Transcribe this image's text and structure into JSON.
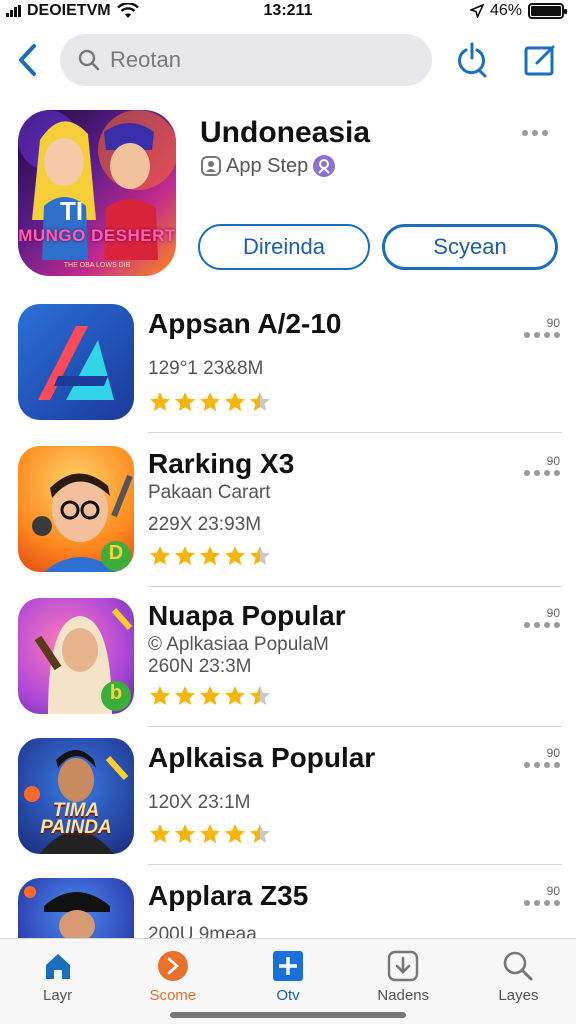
{
  "status_bar": {
    "carrier": "DEOIETVM",
    "time": "13:211",
    "battery": "46%"
  },
  "search": {
    "placeholder": "Reotan"
  },
  "featured": {
    "title": "Undoneasia",
    "subtitle": "App Step",
    "buttons": [
      "Direinda",
      "Scyean"
    ],
    "art_text": "MUNGO DESHERT",
    "art_subtext": "THE OBA LOWS DIB"
  },
  "apps": [
    {
      "name": "Appsan A/2-10",
      "lines": [
        "129°1 23&8M"
      ],
      "rating": 4.5,
      "meta": "90"
    },
    {
      "name": "Rarking X3",
      "lines": [
        "Pakaan Carart",
        "229X 23:93M"
      ],
      "rating": 4.5,
      "meta": "90"
    },
    {
      "name": "Nuapa Popular",
      "lines": [
        "© Aplkasiaa PopulaM",
        "260N 23:3M"
      ],
      "rating": 4.5,
      "meta": "90"
    },
    {
      "name": "Aplkaisa Popular",
      "lines": [
        "120X 23:1M"
      ],
      "rating": 4.5,
      "meta": "90"
    },
    {
      "name": "Applara Z35",
      "lines": [
        "200U 9meaa"
      ],
      "rating": 4.5,
      "meta": "90"
    }
  ],
  "icon_badges": {
    "app2": "D",
    "app3": "b",
    "app4": "TIMA PAINDA"
  },
  "tabs": [
    {
      "label": "Layr",
      "icon": "home-icon"
    },
    {
      "label": "Scome",
      "icon": "chevron-right-circle-icon"
    },
    {
      "label": "Otv",
      "icon": "plus-square-icon"
    },
    {
      "label": "Nadens",
      "icon": "download-icon"
    },
    {
      "label": "Layes",
      "icon": "search-icon"
    }
  ],
  "colors": {
    "accent": "#1a6fbd",
    "star": "#f5b50a",
    "star_empty": "#c8c8c8",
    "tab_orange": "#e8722a"
  }
}
